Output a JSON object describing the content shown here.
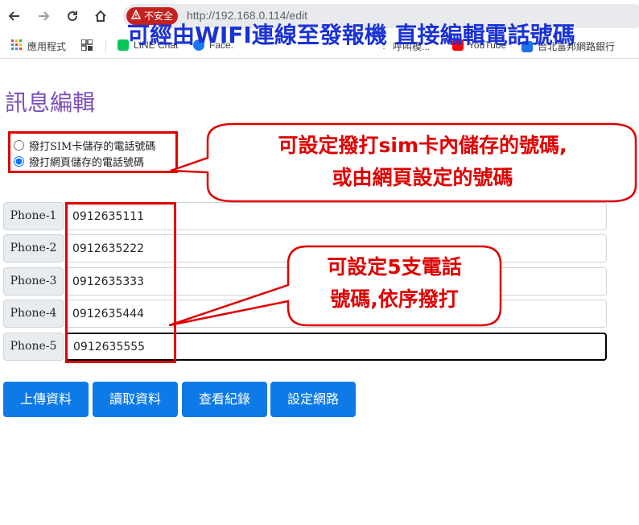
{
  "browser": {
    "back_icon": "back-arrow-icon",
    "forward_icon": "forward-arrow-icon",
    "reload_icon": "reload-icon",
    "home_icon": "home-icon",
    "insecure_label": "不安全",
    "url": "http://192.168.0.114/edit"
  },
  "banner": "可經由WIFI連線至發報機 直接編輯電話號碼",
  "bookmarks": [
    {
      "label": "應用程式",
      "icon": "apps-grid-icon"
    },
    {
      "label": "",
      "icon": "grid-icon"
    },
    {
      "label": "LINE Chat",
      "icon": "line-icon"
    },
    {
      "label": "Face.",
      "icon": "facebook-icon"
    },
    {
      "label": "呼叫模...",
      "icon": "bookmark-icon"
    },
    {
      "label": "YouTube",
      "icon": "youtube-icon"
    },
    {
      "label": "台北富邦網路銀行",
      "icon": "bank-icon"
    }
  ],
  "page": {
    "title": "訊息編輯",
    "radio_options": [
      {
        "label": "撥打SIM卡儲存的電話號碼",
        "checked": false
      },
      {
        "label": "撥打網頁儲存的電話號碼",
        "checked": true
      }
    ],
    "phones": [
      {
        "label": "Phone-1",
        "value": "0912635111"
      },
      {
        "label": "Phone-2",
        "value": "0912635222"
      },
      {
        "label": "Phone-3",
        "value": "0912635333"
      },
      {
        "label": "Phone-4",
        "value": "0912635444"
      },
      {
        "label": "Phone-5",
        "value": "0912635555"
      }
    ],
    "buttons": [
      "上傳資料",
      "讀取資料",
      "查看紀錄",
      "設定網路"
    ]
  },
  "callouts": {
    "top_line1": "可設定撥打sim卡內儲存的號碼,",
    "top_line2": "或由網頁設定的號碼",
    "mid_line1": "可設定5支電話",
    "mid_line2": "號碼,依序撥打"
  },
  "colors": {
    "accent_button": "#0d7ae8",
    "title": "#7c4dba",
    "annotation_red": "#e00000",
    "banner_blue": "#1a32d6"
  }
}
